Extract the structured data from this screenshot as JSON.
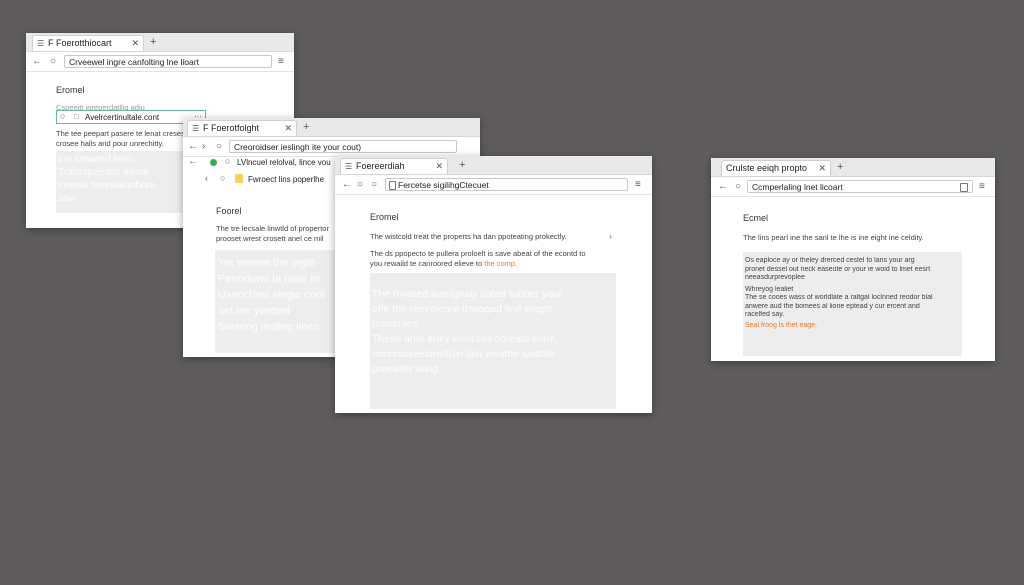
{
  "colors": {
    "desktop": "#5f5c5e",
    "accent": "#e07b2a",
    "ghost_text": "#ffffff"
  },
  "win1": {
    "tab_icon": "page-icon",
    "tab_title": "F Foerotthiocart",
    "omnibox": "Crveewel ingre canfolting lne lioart",
    "heading": "Eromel",
    "overlay_row": "Avelrcertinultale.cont",
    "overlay_row_suffix": "···",
    "blurred_top": "Cspeeitt inreperdatllig adiu",
    "para": "The tee peepart pasere te lenat creses\ncrosee halls and pour unrechitty.",
    "ghost": "Ins siewead leaiu\nTraltsspeealte sleirie\nenseat teneuatunhore\nanw"
  },
  "win2": {
    "tab_title": "F Foerotfolght",
    "omnibox": "Creoroidser ieslingh ite your cout)",
    "url_row_1": "LVlncuel relolval, lince vou",
    "url_row_2": "Fwroect lins poperlhe",
    "heading": "Foorel",
    "para": "The tre lecsale linwtld of propertor\nprooset wrest crosett anel ce mil",
    "ghost": "Yet serane the eigitt\nPeendows la niaie to\nUseoclaes singie cors\naet ine yeetted\nSwaring leafing lines"
  },
  "win3": {
    "tab_title": "Foereerdiah",
    "omnibox": "Fercetse sigilihgCtecuet",
    "heading": "Eromel",
    "para1": "The wistcold treat the properts ha dan ppoteating prokectly.",
    "para2a": "The ds ppopecto te pullera proloelt is save abeat of the econtd to",
    "para2b": "you rewaild te canroored elieve to",
    "para2c": "the comp.",
    "ghost": "The rovated ionsignaly coted tupner your\noffe the reeveleare thwaged line elegte\nprontinies\nThese ante ently woorcas coreate inanl,\nconcrossessinsifuin lain weathe wastite\nproealler aling."
  },
  "win4": {
    "tab_title": "Crulste eeiqh propto",
    "omnibox": "Ccmperlaling lnet licoart",
    "heading": "Ecmel",
    "para": "The lins pearl ine the sanl te lhe is ine eight ine celdity.",
    "card_lines": [
      "Os eaploce ay or theley drerced cestel fo lans your arg",
      "pronet dessel out neck easeute or your ie woid to lmet eesrt",
      "neeasdurprevoplee",
      "Whreyog lealiet",
      "The se cooes wass of worldlate a raltgal loclnned reodor blal",
      "anwere aud the bomees al lione eptead y cur ercent and",
      "racelfed say."
    ],
    "card_accent_prefix": "Seal froog ls",
    "card_accent": "thet eage."
  }
}
